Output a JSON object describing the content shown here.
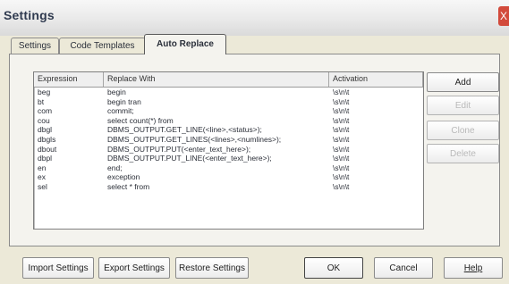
{
  "window": {
    "title": "Settings",
    "close_glyph": "X"
  },
  "tabs": [
    {
      "label": "Settings"
    },
    {
      "label": "Code Templates"
    },
    {
      "label": "Auto Replace"
    }
  ],
  "table": {
    "headers": [
      "Expression",
      "Replace With",
      "Activation"
    ],
    "rows": [
      [
        "beg",
        "begin",
        "\\s\\n\\t"
      ],
      [
        "bt",
        "begin tran",
        "\\s\\n\\t"
      ],
      [
        "com",
        "commit;",
        "\\s\\n\\t"
      ],
      [
        "cou",
        "select count(*) from",
        "\\s\\n\\t"
      ],
      [
        "dbgl",
        "DBMS_OUTPUT.GET_LINE(<line>,<status>);",
        "\\s\\n\\t"
      ],
      [
        "dbgls",
        "DBMS_OUTPUT.GET_LINES(<lines>,<numlines>);",
        "\\s\\n\\t"
      ],
      [
        "dbout",
        "DBMS_OUTPUT.PUT(<enter_text_here>);",
        "\\s\\n\\t"
      ],
      [
        "dbpl",
        "DBMS_OUTPUT.PUT_LINE(<enter_text_here>);",
        "\\s\\n\\t"
      ],
      [
        "en",
        "end;",
        "\\s\\n\\t"
      ],
      [
        "ex",
        "exception",
        "\\s\\n\\t"
      ],
      [
        "sel",
        "select * from",
        "\\s\\n\\t"
      ]
    ]
  },
  "side_buttons": {
    "add": "Add",
    "edit": "Edit",
    "clone": "Clone",
    "delete": "Delete"
  },
  "bottom_buttons": {
    "import": "Import Settings",
    "export": "Export Settings",
    "restore": "Restore Settings",
    "ok": "OK",
    "cancel": "Cancel",
    "help": "Help"
  }
}
